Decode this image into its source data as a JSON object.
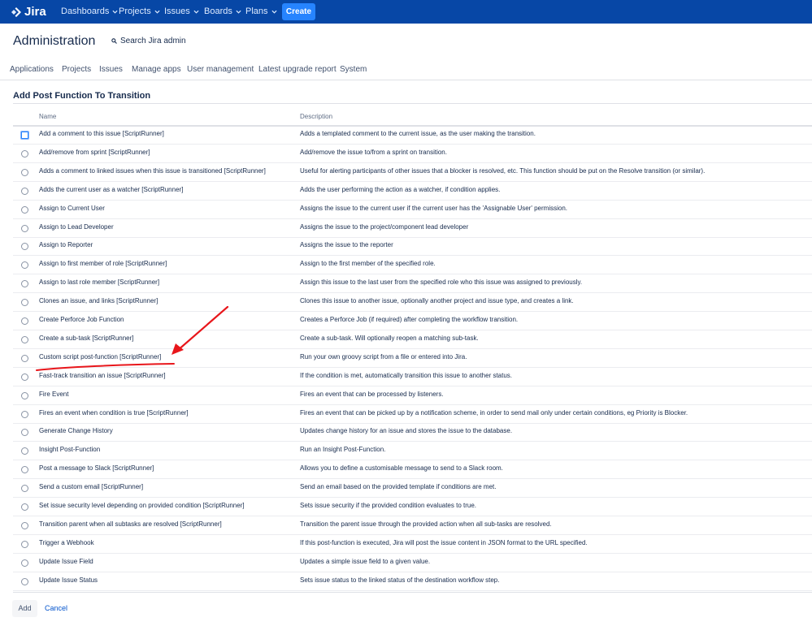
{
  "topbar": {
    "logo_text": "Jira",
    "nav": [
      "Dashboards",
      "Projects",
      "Issues",
      "Boards",
      "Plans"
    ],
    "create_label": "Create"
  },
  "page": {
    "title": "Administration",
    "search_label": "Search Jira admin"
  },
  "tabs": [
    "Applications",
    "Projects",
    "Issues",
    "Manage apps",
    "User management",
    "Latest upgrade report",
    "System"
  ],
  "section_title": "Add Post Function To Transition",
  "table": {
    "headers": {
      "name": "Name",
      "description": "Description"
    },
    "rows": [
      {
        "name": "Add a comment to this issue [ScriptRunner]",
        "description": "Adds a templated comment to the current issue, as the user making the transition.",
        "selected": true
      },
      {
        "name": "Add/remove from sprint [ScriptRunner]",
        "description": "Add/remove the issue to/from a sprint on transition."
      },
      {
        "name": "Adds a comment to linked issues when this issue is transitioned [ScriptRunner]",
        "description": "Useful for alerting participants of other issues that a blocker is resolved, etc. This function should be put on the Resolve transition (or similar)."
      },
      {
        "name": "Adds the current user as a watcher [ScriptRunner]",
        "description": "Adds the user performing the action as a watcher, if condition applies."
      },
      {
        "name": "Assign to Current User",
        "description": "Assigns the issue to the current user if the current user has the 'Assignable User' permission."
      },
      {
        "name": "Assign to Lead Developer",
        "description": "Assigns the issue to the project/component lead developer"
      },
      {
        "name": "Assign to Reporter",
        "description": "Assigns the issue to the reporter"
      },
      {
        "name": "Assign to first member of role [ScriptRunner]",
        "description": "Assign to the first member of the specified role."
      },
      {
        "name": "Assign to last role member [ScriptRunner]",
        "description": "Assign this issue to the last user from the specified role who this issue was assigned to previously."
      },
      {
        "name": "Clones an issue, and links [ScriptRunner]",
        "description": "Clones this issue to another issue, optionally another project and issue type, and creates a link."
      },
      {
        "name": "Create Perforce Job Function",
        "description": "Creates a Perforce Job (if required) after completing the workflow transition."
      },
      {
        "name": "Create a sub-task [ScriptRunner]",
        "description": "Create a sub-task. Will optionally reopen a matching sub-task."
      },
      {
        "name": "Custom script post-function [ScriptRunner]",
        "description": "Run your own groovy script from a file or entered into Jira."
      },
      {
        "name": "Fast-track transition an issue [ScriptRunner]",
        "description": "If the condition is met, automatically transition this issue to another status."
      },
      {
        "name": "Fire Event",
        "description": "Fires an event that can be processed by listeners."
      },
      {
        "name": "Fires an event when condition is true [ScriptRunner]",
        "description": "Fires an event that can be picked up by a notification scheme, in order to send mail only under certain conditions, eg Priority is Blocker."
      },
      {
        "name": "Generate Change History",
        "description": "Updates change history for an issue and stores the issue to the database."
      },
      {
        "name": "Insight Post-Function",
        "description": "Run an Insight Post-Function."
      },
      {
        "name": "Post a message to Slack [ScriptRunner]",
        "description": "Allows you to define a customisable message to send to a Slack room."
      },
      {
        "name": "Send a custom email [ScriptRunner]",
        "description": "Send an email based on the provided template if conditions are met."
      },
      {
        "name": "Set issue security level depending on provided condition [ScriptRunner]",
        "description": "Sets issue security if the provided condition evaluates to true."
      },
      {
        "name": "Transition parent when all subtasks are resolved [ScriptRunner]",
        "description": "Transition the parent issue through the provided action when all sub-tasks are resolved."
      },
      {
        "name": "Trigger a Webhook",
        "description": "If this post-function is executed, Jira will post the issue content in JSON format to the URL specified."
      },
      {
        "name": "Update Issue Field",
        "description": "Updates a simple issue field to a given value."
      },
      {
        "name": "Update Issue Status",
        "description": "Sets issue status to the linked status of the destination workflow step."
      }
    ]
  },
  "footer": {
    "add_label": "Add",
    "cancel_label": "Cancel"
  },
  "colors": {
    "topbar": "#0747a6",
    "create": "#2684ff",
    "link": "#0052cc",
    "annotation": "#e8161b"
  },
  "icons": [
    "jira-logo-icon",
    "chevron-down-icon",
    "search-icon",
    "arrow-annotation"
  ]
}
